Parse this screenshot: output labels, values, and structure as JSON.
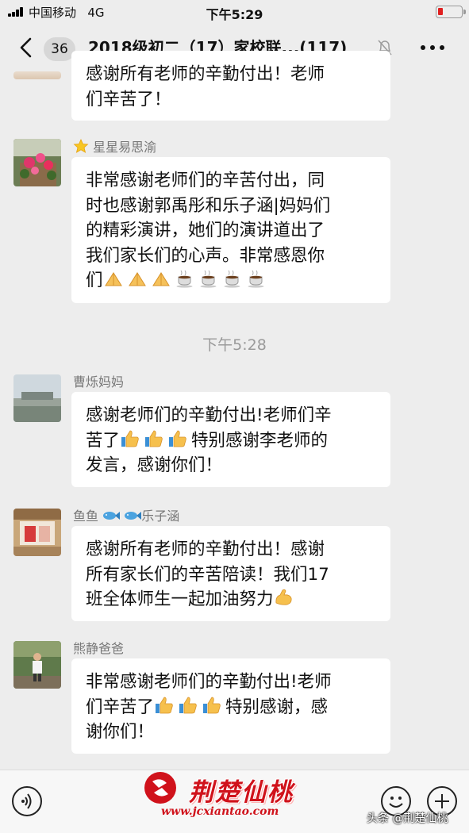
{
  "status_bar": {
    "carrier": "中国移动",
    "network": "4G",
    "time": "下午5:29"
  },
  "nav": {
    "unread_count": "36",
    "title": "2018级初二（17）家校联...",
    "member_count": "(117)"
  },
  "messages": [
    {
      "partial": true,
      "text_line1": "感谢所有老师的辛勤付出！老师",
      "text_line2": "们辛苦了！"
    },
    {
      "sender": "星星易思渝",
      "text": "非常感谢老师们的辛苦付出，同时也感谢郭禹彤和乐子涵|妈妈们的精彩演讲，她们的演讲道出了我们家长们的心声。非常感恩你们",
      "line1": "非常感谢老师们的辛苦付出，同",
      "line2": "时也感谢郭禹彤和乐子涵|妈妈们",
      "line3": "的精彩演讲，她们的演讲道出了",
      "line4": "我们家长们的心声。非常感恩你",
      "line5": "们"
    },
    {
      "sender": "曹烁妈妈",
      "line1": "感谢老师们的辛勤付出!老师们辛",
      "line2a": "苦了",
      "line2b": "特别感谢李老师的",
      "line3": "发言，感谢你们！"
    },
    {
      "sender_a": "鱼鱼",
      "sender_b": "乐子涵",
      "line1": "感谢所有老师的辛勤付出！感谢",
      "line2": "所有家长们的辛苦陪读！我们17",
      "line3": "班全体师生一起加油努力"
    },
    {
      "sender": "熊静爸爸",
      "line1": "非常感谢老师们的辛勤付出!老师",
      "line2a": "们辛苦了",
      "line2b": "特别感谢，感",
      "line3": "谢你们！"
    }
  ],
  "timestamp": "下午5:28",
  "watermark": {
    "brand": "荆楚仙桃",
    "url": "www.jcxiantao.com",
    "credit": "头条 @荆楚仙桃"
  },
  "emoji": {
    "pray": "pray-hands-emoji",
    "coffee": "hot-beverage-emoji",
    "thumbs": "thumbs-up-emoji",
    "muscle": "flexed-biceps-emoji",
    "fish": "fish-emoji",
    "star": "glowing-star-emoji"
  },
  "colors": {
    "background": "#ededed",
    "bubble": "#ffffff",
    "watermark_red": "#d0121b"
  }
}
